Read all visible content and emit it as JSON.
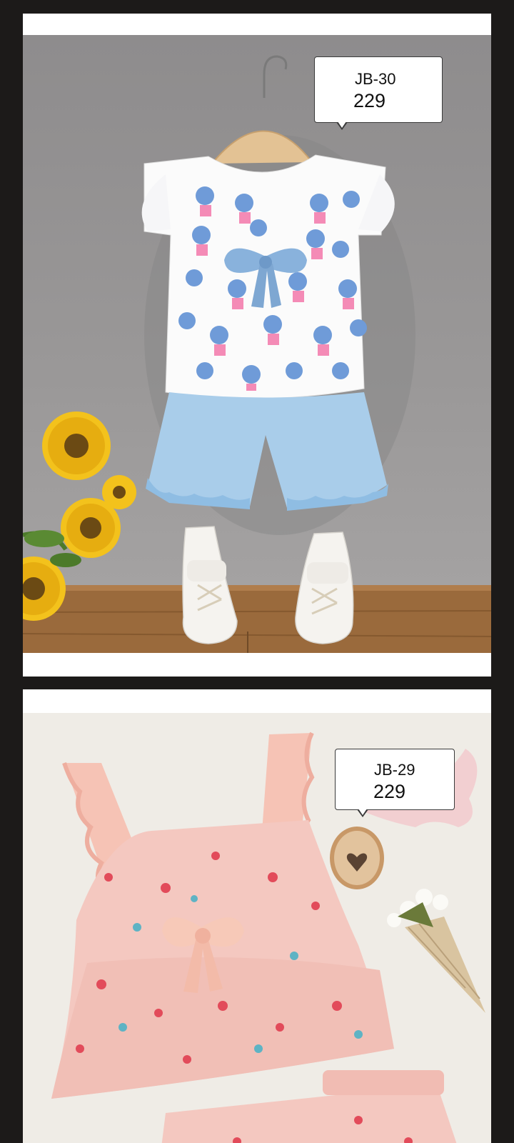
{
  "products": [
    {
      "code": "JB-30",
      "price": "229"
    },
    {
      "code": "JB-29",
      "price": "229"
    }
  ],
  "colors": {
    "background": "#1c1a19",
    "card": "#ffffff",
    "wall": "#9a9898",
    "table": "#9a6a3c",
    "shorts_blue": "#a9cdea",
    "floral_pink": "#f4c8c0",
    "linen": "#efece6"
  },
  "icons": [
    "heart-icon"
  ]
}
